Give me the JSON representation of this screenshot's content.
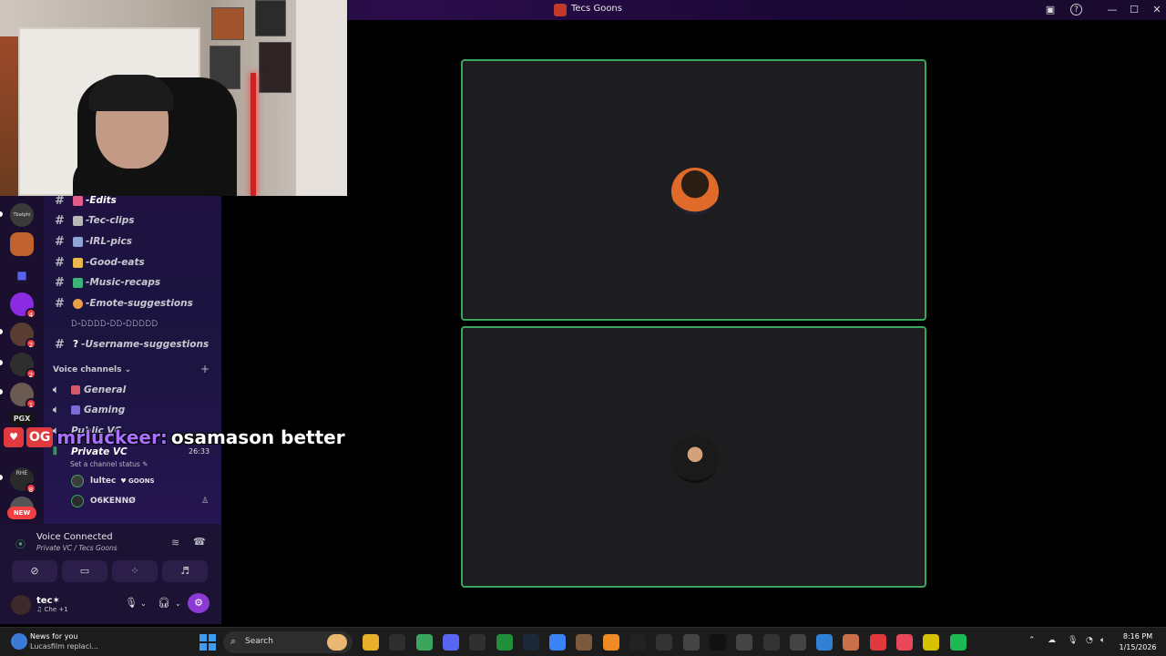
{
  "window": {
    "title": "Tecs Goons",
    "controls": {
      "minimize": "—",
      "maximize": "☐",
      "close": "✕",
      "help": "?",
      "screen": "▣"
    }
  },
  "server_rail": {
    "servers": [
      {
        "name": "Tbatphi",
        "label": "Tbatphi",
        "color": "#3a3a3a",
        "badge": ""
      },
      {
        "name": "server-orange-avatar",
        "label": "",
        "color": "#c0622e",
        "badge": ""
      },
      {
        "name": "folder",
        "label": "",
        "color": "#3b4fb8",
        "badge": ""
      },
      {
        "name": "server-purple",
        "label": "",
        "color": "#8a2be2",
        "badge": "4"
      },
      {
        "name": "server-person-1",
        "label": "",
        "color": "#5a3d32",
        "badge": "2"
      },
      {
        "name": "server-person-2",
        "label": "",
        "color": "#2e2e2e",
        "badge": "2"
      },
      {
        "name": "server-person-3",
        "label": "",
        "color": "#6b5a52",
        "badge": "1"
      },
      {
        "name": "server-pgx",
        "label": "PGX",
        "color": "#151515",
        "badge": ""
      },
      {
        "name": "server-dark",
        "label": "",
        "color": "#333",
        "badge": ""
      },
      {
        "name": "server-rhe",
        "label": "RHE",
        "color": "#2a2a2a",
        "badge": "8"
      },
      {
        "name": "server-new",
        "label": "",
        "color": "#555",
        "badge": ""
      }
    ],
    "new_label": "NEW"
  },
  "channels": {
    "text": [
      {
        "name": "-Edits",
        "emoji_color": "#e35d8a"
      },
      {
        "name": "-Tec-clips",
        "emoji_color": "#b8b8b8"
      },
      {
        "name": "-IRL-pics",
        "emoji_color": "#8fa3d6"
      },
      {
        "name": "-Good-eats",
        "emoji_color": "#e8b84a"
      },
      {
        "name": "-Music-recaps",
        "emoji_color": "#3bb37a"
      },
      {
        "name": "-Emote-suggestions",
        "emoji_color": "#e8a04a"
      },
      {
        "name": "𝙳-𝙳𝙳𝙳𝙳-𝙳𝙳-𝙳𝙳𝙳𝙳𝙳",
        "emoji_color": ""
      },
      {
        "name": "-Username-suggestions",
        "emoji_color": "#ffffff"
      }
    ],
    "voice_section": "Voice channels",
    "voice": [
      {
        "name": "General",
        "emoji_color": "#d45a6a"
      },
      {
        "name": "Gaming",
        "emoji_color": "#7a6ad6"
      },
      {
        "name": "Public VC",
        "emoji_color": ""
      },
      {
        "name": "Private VC",
        "emoji_color": ""
      }
    ],
    "active_vc_time": "26:33",
    "channel_status": "Set a channel status",
    "members": [
      {
        "name": "lultec",
        "tag": "♥ GOONS",
        "color": "#3c3c3c"
      },
      {
        "name": "O6KENNØ",
        "tag": "",
        "color": "#2b2b2b"
      }
    ]
  },
  "voice_panel": {
    "title": "Voice Connected",
    "subtitle": "Private VC / Tecs Goons",
    "user": {
      "name": "tec✶",
      "status": "♫ Che +1"
    }
  },
  "chat_overlay": {
    "badge": "OG",
    "username": "mrluckeer:",
    "message": "osamason better"
  },
  "taskbar": {
    "news_title": "News for you",
    "news_sub": "Lucasfilm replaci...",
    "search_placeholder": "Search",
    "time": "8:16 PM",
    "date": "1/15/2026",
    "apps": [
      {
        "name": "file-explorer",
        "color": "#e8b02a"
      },
      {
        "name": "store",
        "color": "#2e2e2e"
      },
      {
        "name": "chrome",
        "color": "#3aa55d"
      },
      {
        "name": "discord",
        "color": "#5865f2"
      },
      {
        "name": "obs",
        "color": "#303030"
      },
      {
        "name": "xbox",
        "color": "#1f8f3a"
      },
      {
        "name": "steam",
        "color": "#1b2838"
      },
      {
        "name": "browser",
        "color": "#3b82f6"
      },
      {
        "name": "minecraft",
        "color": "#7a5a3a"
      },
      {
        "name": "vlc",
        "color": "#f08a24"
      },
      {
        "name": "pen",
        "color": "#222"
      },
      {
        "name": "settings",
        "color": "#333"
      },
      {
        "name": "snip",
        "color": "#444"
      },
      {
        "name": "tiktok",
        "color": "#111"
      },
      {
        "name": "record",
        "color": "#444"
      },
      {
        "name": "4k",
        "color": "#333"
      },
      {
        "name": "grid-app",
        "color": "#444"
      },
      {
        "name": "edge",
        "color": "#2f7fd6"
      },
      {
        "name": "notes",
        "color": "#c96f4a"
      },
      {
        "name": "youtube",
        "color": "#e03a3e"
      },
      {
        "name": "music",
        "color": "#e8475a"
      },
      {
        "name": "face-app",
        "color": "#d6c000"
      },
      {
        "name": "spotify",
        "color": "#1db954"
      }
    ]
  }
}
